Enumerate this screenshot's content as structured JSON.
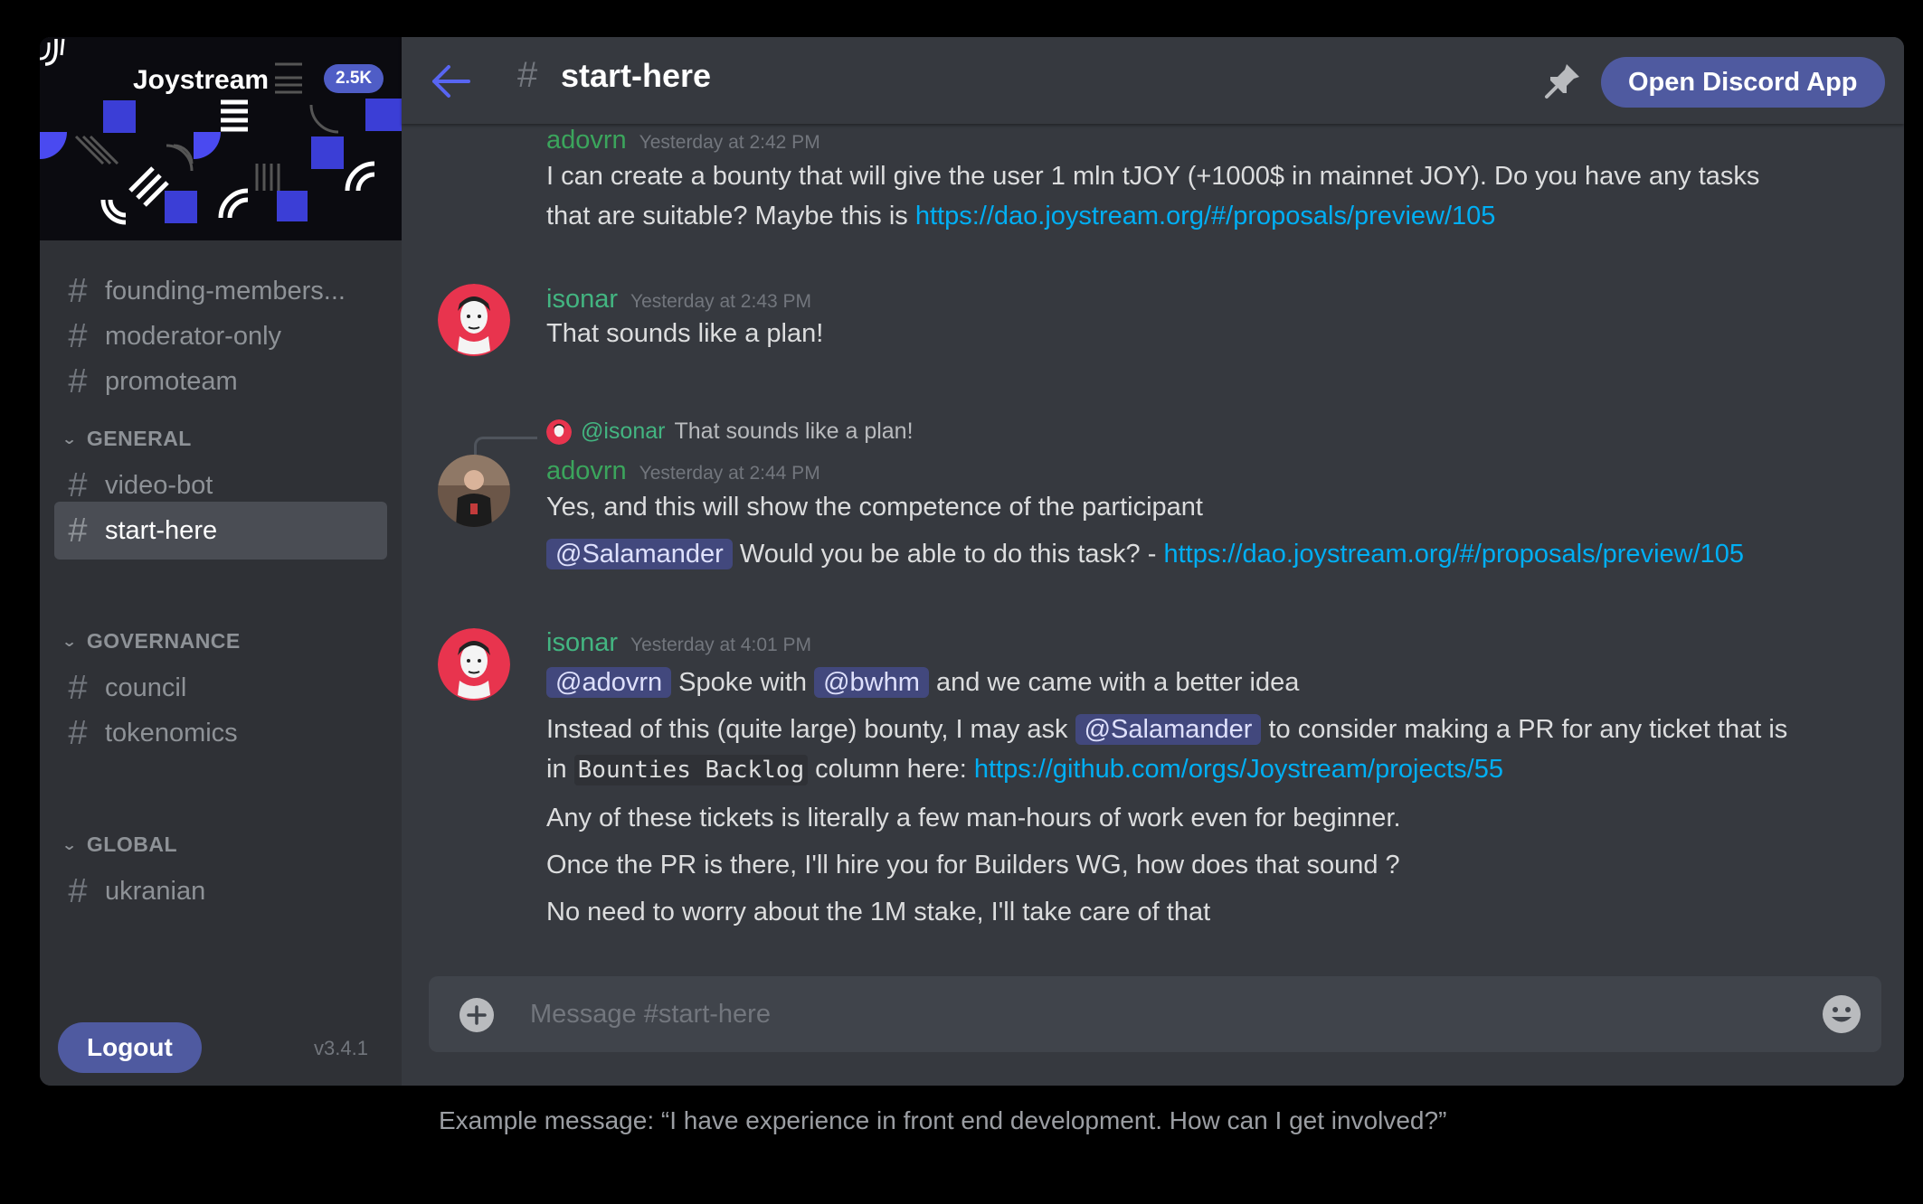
{
  "server": {
    "name": "Joystream",
    "member_count": "2.5K",
    "version": "v3.4.1",
    "logout_label": "Logout"
  },
  "sidebar": {
    "channels_top": [
      {
        "name": "founding-members..."
      },
      {
        "name": "moderator-only"
      },
      {
        "name": "promoteam"
      }
    ],
    "categories": [
      {
        "label": "GENERAL",
        "channels": [
          {
            "name": "video-bot"
          },
          {
            "name": "start-here",
            "active": true
          }
        ]
      },
      {
        "label": "GOVERNANCE",
        "channels": [
          {
            "name": "council"
          },
          {
            "name": "tokenomics"
          }
        ]
      },
      {
        "label": "GLOBAL",
        "channels": [
          {
            "name": "ukranian"
          }
        ]
      }
    ]
  },
  "header": {
    "channel": "start-here",
    "open_app_label": "Open Discord App"
  },
  "messages": [
    {
      "author": "adovrn",
      "time": "Yesterday at 2:42 PM",
      "lines": {
        "l1": "I can create a bounty that will give the user 1 mln tJOY (+1000$ in mainnet JOY). Do you have any tasks",
        "l2_text": "that are suitable? Maybe this is ",
        "l2_link": "https://dao.joystream.org/#/proposals/preview/105"
      }
    },
    {
      "author": "isonar",
      "time": "Yesterday at 2:43 PM",
      "lines": {
        "l1": "That sounds like a plan!"
      }
    },
    {
      "reply_to": {
        "author": "@isonar",
        "text": "That sounds like a plan!"
      },
      "author": "adovrn",
      "time": "Yesterday at 2:44 PM",
      "lines": {
        "l1": "Yes, and this will show the competence of the participant",
        "l2_mention": "@Salamander",
        "l2_text": " Would you be able to do this task? - ",
        "l2_link": "https://dao.joystream.org/#/proposals/preview/105"
      }
    },
    {
      "author": "isonar",
      "time": "Yesterday at 4:01 PM",
      "lines": {
        "l1_mention1": "@adovrn",
        "l1_text1": " Spoke with ",
        "l1_mention2": "@bwhm",
        "l1_text2": " and we came with a better idea",
        "l2_text1": "Instead of this (quite large) bounty, I may ask ",
        "l2_mention": "@Salamander",
        "l2_text2": " to consider making a PR for any ticket that is",
        "l3_text1": "in ",
        "l3_code": "Bounties Backlog",
        "l3_text2": " column here: ",
        "l3_link": "https://github.com/orgs/Joystream/projects/55",
        "l4": "Any of these tickets is literally a few man-hours of work even for beginner.",
        "l5": "Once the PR is there, I'll hire you for Builders WG, how does that sound ?",
        "l6": "No need to worry about the 1M stake, I'll take care of that"
      }
    }
  ],
  "composer": {
    "placeholder": "Message #start-here"
  },
  "caption": "Example message: “I have experience in front end development. How can I get involved?”",
  "icons": {
    "back": "arrow-left-icon",
    "pin": "pin-icon",
    "add": "plus-circle-icon",
    "emoji": "emoji-icon"
  },
  "colors": {
    "accent": "#4f5aa0",
    "link": "#00aff4",
    "author_green": "#3ba55c",
    "background": "#36393f",
    "sidebar": "#2f3136"
  }
}
